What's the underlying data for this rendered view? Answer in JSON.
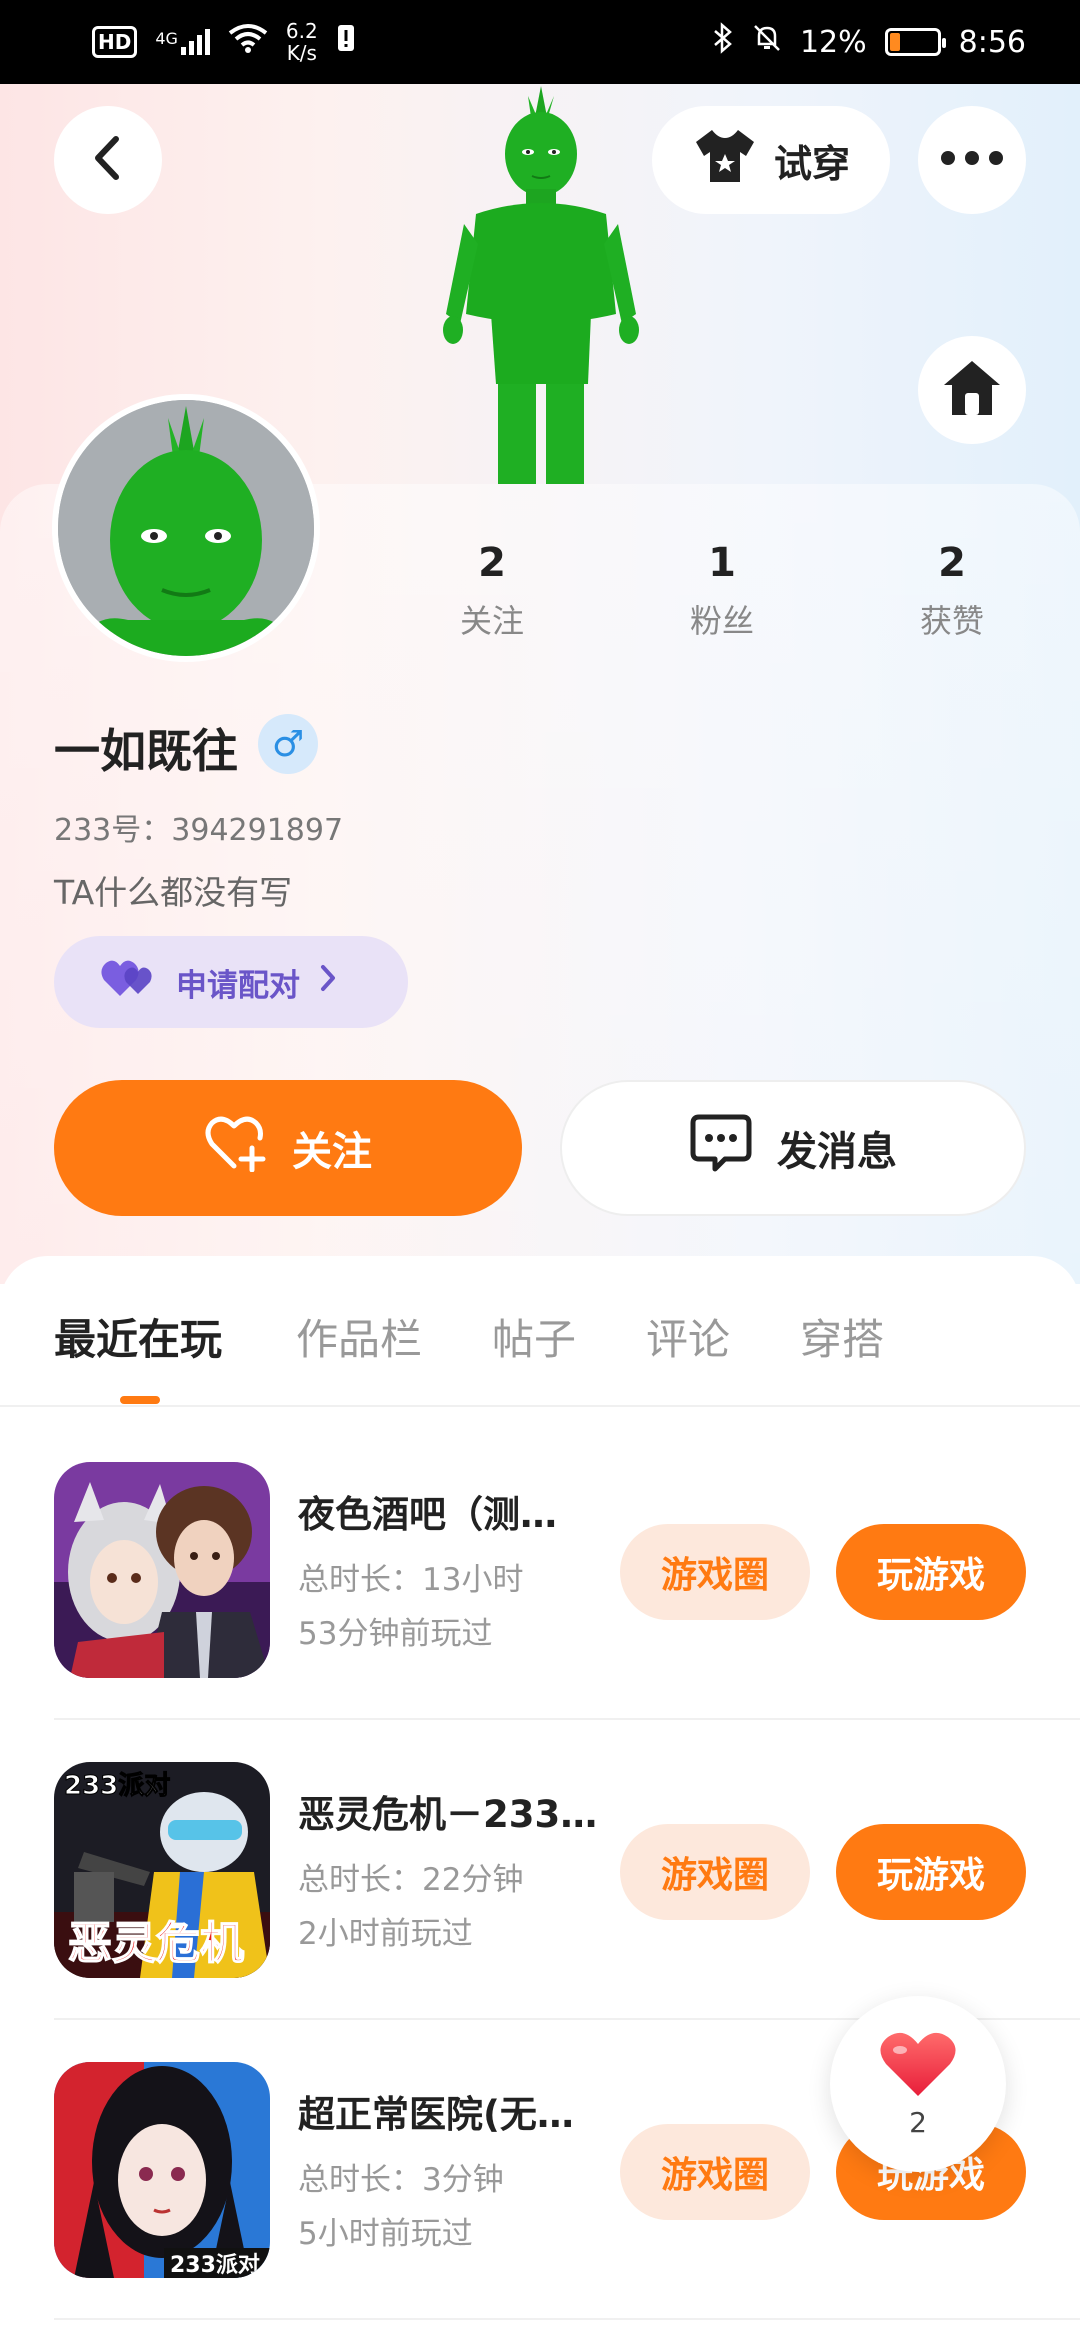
{
  "status_bar": {
    "hd": "HD",
    "network": "4G",
    "speed_value": "6.2",
    "speed_unit": "K/s",
    "battery_percent": "12%",
    "time": "8:56"
  },
  "header": {
    "try_on_label": "试穿"
  },
  "stats": [
    {
      "value": "2",
      "label": "关注"
    },
    {
      "value": "1",
      "label": "粉丝"
    },
    {
      "value": "2",
      "label": "获赞"
    }
  ],
  "profile": {
    "nickname": "一如既往",
    "gender_symbol": "♂",
    "uid_label": "233号：",
    "uid": "394291897",
    "bio": "TA什么都没有写",
    "pair_label": "申请配对"
  },
  "actions": {
    "follow_label": "关注",
    "message_label": "发消息"
  },
  "tabs": [
    "最近在玩",
    "作品栏",
    "帖子",
    "评论",
    "穿搭"
  ],
  "games": [
    {
      "title": "夜色酒吧（测…",
      "duration": "总时长：13小时",
      "last_played": "53分钟前玩过",
      "circle_label": "游戏圈",
      "play_label": "玩游戏",
      "icon_text": ""
    },
    {
      "title": "恶灵危机－233…",
      "duration": "总时长：22分钟",
      "last_played": "2小时前玩过",
      "circle_label": "游戏圈",
      "play_label": "玩游戏",
      "icon_text": "233派对",
      "icon_text2": "恶灵危机"
    },
    {
      "title": "超正常医院(无…",
      "duration": "总时长：3分钟",
      "last_played": "5小时前玩过",
      "circle_label": "游戏圈",
      "play_label": "玩游戏",
      "icon_text": "233派对"
    }
  ],
  "floating_like": {
    "count": "2"
  },
  "colors": {
    "accent": "#ff7a12",
    "accent_light": "#fde8dc",
    "pair_bg": "#e9e2f7",
    "pair_text": "#6a55c8"
  }
}
